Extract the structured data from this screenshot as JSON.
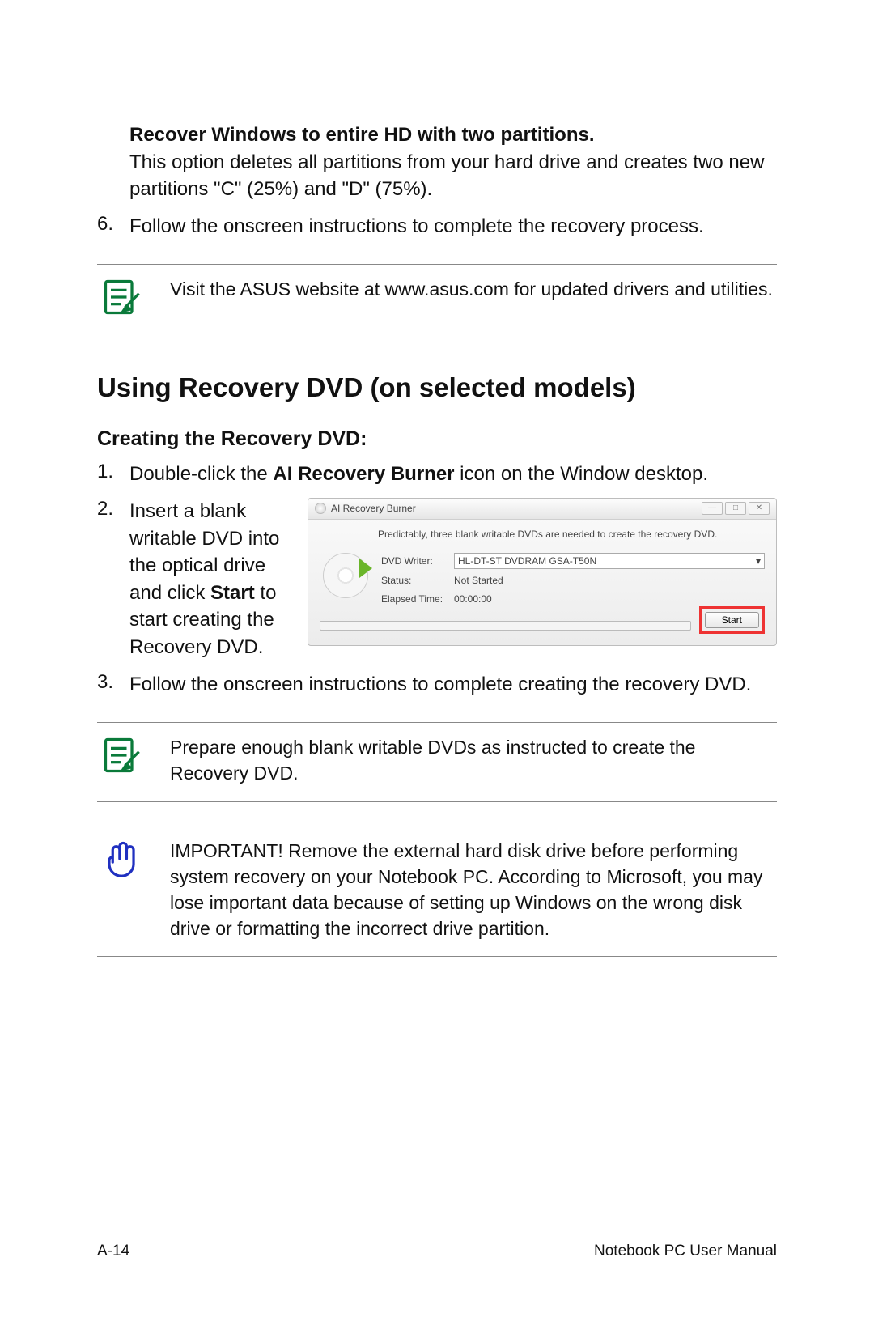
{
  "section_intro": {
    "heading": "Recover Windows to entire HD with two partitions.",
    "body": "This option deletes all partitions from your hard drive and creates two new partitions \"C\" (25%) and \"D\" (75%)."
  },
  "step6": {
    "num": "6.",
    "text": "Follow the onscreen instructions to complete the recovery process."
  },
  "note1": "Visit the ASUS website at www.asus.com for updated drivers and utilities.",
  "main_heading": "Using Recovery DVD (on selected models)",
  "sub_heading": "Creating the Recovery DVD:",
  "step1": {
    "num": "1.",
    "pre": "Double-click the ",
    "bold": "AI Recovery Burner",
    "post": " icon on the Window desktop."
  },
  "step2": {
    "num": "2.",
    "pre": "Insert a blank writable DVD into the optical drive and click ",
    "bold": "Start",
    "post": " to start creating the Recovery DVD."
  },
  "step3": {
    "num": "3.",
    "text": "Follow the onscreen instructions to complete creating the recovery DVD."
  },
  "note2": "Prepare enough blank writable DVDs as instructed to create the Recovery DVD.",
  "note3": "IMPORTANT! Remove the external hard disk drive before performing system recovery on your Notebook PC. According to Microsoft, you may lose important data because of setting up Windows on the wrong disk drive or formatting the incorrect drive partition.",
  "app": {
    "title": "AI Recovery Burner",
    "hint": "Predictably, three blank writable DVDs are needed to create the recovery DVD.",
    "writer_label": "DVD Writer:",
    "writer_value": "HL-DT-ST DVDRAM GSA-T50N",
    "status_label": "Status:",
    "status_value": "Not Started",
    "elapsed_label": "Elapsed Time:",
    "elapsed_value": "00:00:00",
    "start_label": "Start",
    "win_min": "—",
    "win_max": "□",
    "win_close": "✕"
  },
  "footer": {
    "page": "A-14",
    "title": "Notebook PC User Manual"
  }
}
